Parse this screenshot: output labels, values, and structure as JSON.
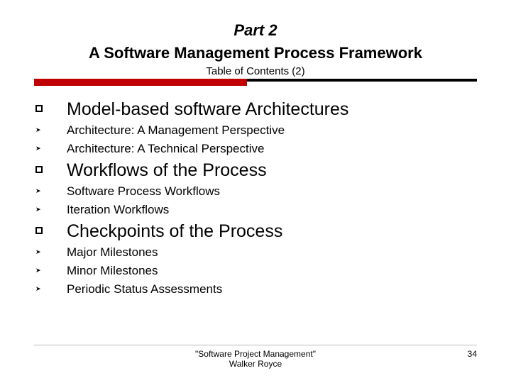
{
  "header": {
    "part": "Part 2",
    "subtitle": "A Software Management Process Framework",
    "toc": "Table of Contents (2)"
  },
  "sections": [
    {
      "title": "Model-based software Architectures",
      "items": [
        "Architecture: A Management Perspective",
        "Architecture: A Technical Perspective"
      ]
    },
    {
      "title": "Workflows of the Process",
      "items": [
        "Software Process Workflows",
        "Iteration Workflows"
      ]
    },
    {
      "title": "Checkpoints of the Process",
      "items": [
        "Major Milestones",
        "Minor Milestones",
        "Periodic Status Assessments"
      ]
    }
  ],
  "footer": {
    "book": "\"Software Project Management\"",
    "author": "Walker Royce",
    "page": "34"
  }
}
